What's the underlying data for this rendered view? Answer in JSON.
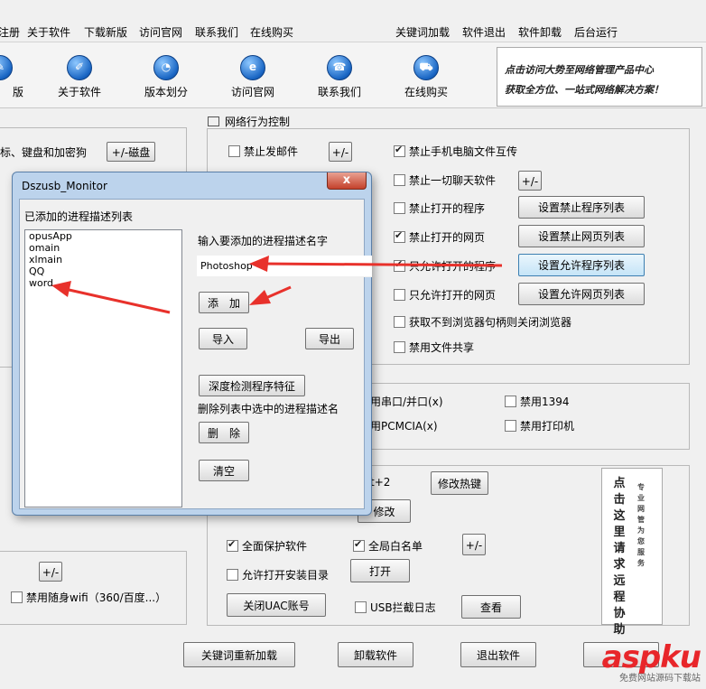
{
  "menu": {
    "items": [
      "注册",
      "关于软件",
      "下载新版",
      "访问官网",
      "联系我们",
      "在线购买"
    ],
    "right_items": [
      "关键词加载",
      "软件退出",
      "软件卸载",
      "后台运行"
    ]
  },
  "toolbar": {
    "items": [
      {
        "label": "版",
        "icon": "register-icon"
      },
      {
        "label": "关于软件",
        "icon": "edit-icon"
      },
      {
        "label": "版本划分",
        "icon": "pie-chart-icon"
      },
      {
        "label": "访问官网",
        "icon": "browser-icon"
      },
      {
        "label": "联系我们",
        "icon": "phone-icon"
      },
      {
        "label": "在线购买",
        "icon": "cart-icon"
      }
    ],
    "banner_line1": "点击访问大势至网络管理产品中心",
    "banner_line2": "获取全方位、一站式网络解决方案！"
  },
  "left_panel": {
    "text1": "标、键盘和加密狗",
    "disk_button": "+/-磁盘"
  },
  "network": {
    "title": "网络行为控制",
    "block_email": "禁止发邮件",
    "block_file_transfer": "禁止手机电脑文件互传",
    "block_chat": "禁止一切聊天软件",
    "block_programs": "禁止打开的程序",
    "block_webpages": "禁止打开的网页",
    "allow_programs": "只允许打开的程序",
    "allow_webpages": "只允许打开的网页",
    "close_browser": "获取不到浏览器句柄则关闭浏览器",
    "disable_share": "禁用文件共享",
    "plus_minus": "+/-",
    "set_block_programs": "设置禁止程序列表",
    "set_block_webpages": "设置禁止网页列表",
    "set_allow_programs": "设置允许程序列表",
    "set_allow_webpages": "设置允许网页列表"
  },
  "devices": {
    "serial": "用串口/并口(x)",
    "pcmcia": "用PCMCIA(x)",
    "ieee1394": "禁用1394",
    "printer": "禁用打印机"
  },
  "hotkey": {
    "partial": "t+2",
    "modify_hotkey": "修改热键",
    "modify": "修改",
    "full_protect": "全面保护软件",
    "global_whitelist": "全局白名单",
    "allow_install_dir": "允许打开安装目录",
    "open": "打开",
    "close_uac": "关闭UAC账号",
    "usb_log": "USB拦截日志",
    "view": "查看"
  },
  "left_bottom": {
    "wifi": "禁用随身wifi（360/百度...）",
    "plus_minus": "+/-"
  },
  "bottom_buttons": {
    "reload": "关键词重新加载",
    "uninstall": "卸载软件",
    "exit": "退出软件"
  },
  "side_ad": {
    "col1": "点击这里请求远程协助",
    "col2": "专业网管为您服务"
  },
  "dialog": {
    "title": "Dszusb_Monitor",
    "close": "x",
    "list_label": "已添加的进程描述列表",
    "processes": [
      "opusApp",
      "omain",
      "xlmain",
      "QQ",
      "word"
    ],
    "input_label": "输入要添加的进程描述名字",
    "input_value": "Photoshop",
    "add": "添　加",
    "import": "导入",
    "export": "导出",
    "deep_check": "深度检测程序特征",
    "delete_label": "删除列表中选中的进程描述名",
    "delete": "删　除",
    "clear": "清空"
  },
  "watermark": {
    "logo": "aspku",
    "sub": "免费网站源码下载站"
  },
  "colors": {
    "arrow": "#e8312b",
    "dialog_frame": "#bcd3ec",
    "accent": "#1a66c4"
  }
}
